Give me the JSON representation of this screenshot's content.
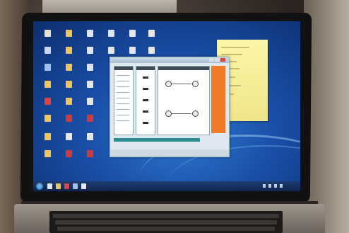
{
  "scene": {
    "description_tags": [
      "laptop",
      "desktop",
      "application-window",
      "sticky-note",
      "keyboard"
    ]
  },
  "desktop": {
    "colors": {
      "wallpaper": "#1a4fa8",
      "taskbar": "#0f2348",
      "note": "#efe58a",
      "accent_orange": "#f07b26"
    },
    "icon_names": [
      "folder-icon",
      "document-icon",
      "app-icon"
    ]
  },
  "app_window": {
    "icon_names": [
      "switch-icon",
      "circuit-node-icon"
    ]
  },
  "sticky_note": {
    "icon_names": [
      "note-icon"
    ]
  }
}
